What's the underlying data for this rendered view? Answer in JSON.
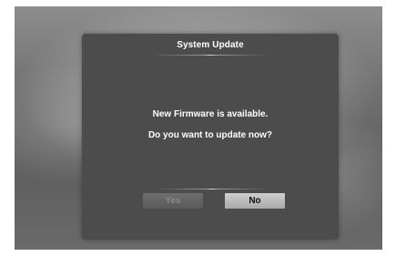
{
  "dialog": {
    "title": "System Update",
    "message_line1": "New Firmware is available.",
    "message_line2": "Do you want to update now?",
    "buttons": {
      "yes": "Yes",
      "no": "No"
    },
    "focused_button": "No"
  },
  "colors": {
    "dialog_background": "#4c4c4c",
    "text": "#ffffff",
    "button_focused": "#bfbfbf",
    "button_unfocused": "#636363",
    "button_unfocused_text": "#8a8a8a"
  }
}
